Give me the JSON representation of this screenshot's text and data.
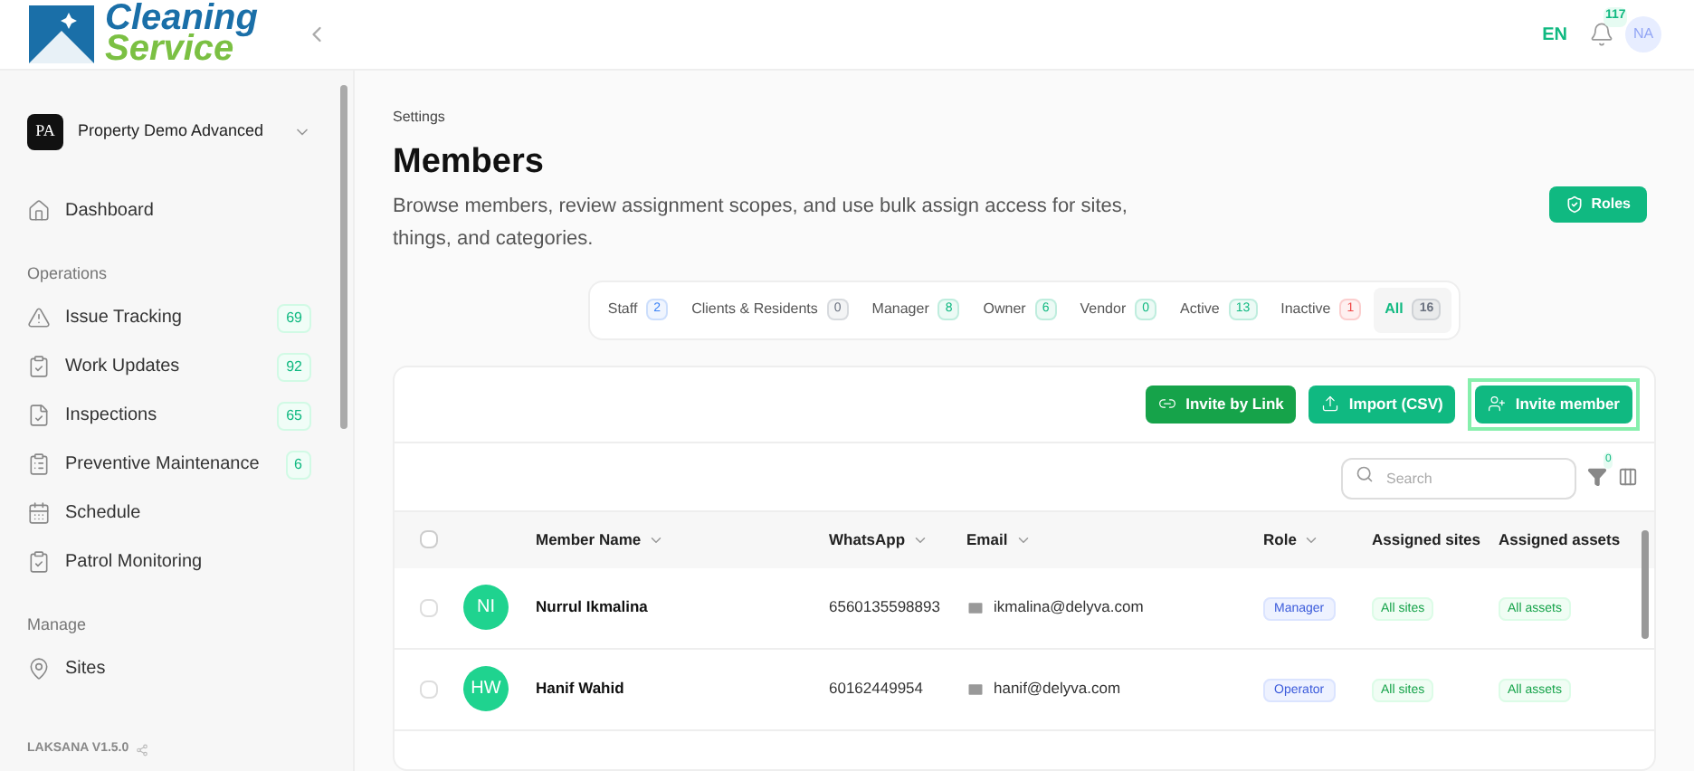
{
  "header": {
    "logo": [
      "Cleaning",
      "Service"
    ],
    "language": {
      "label": "EN",
      "selected": true
    },
    "notifications": "117",
    "avatar": "NA"
  },
  "sidebar": {
    "workspace": {
      "initials": "PA",
      "name": "Property Demo Advanced"
    },
    "items": [
      {
        "label": "Dashboard"
      }
    ],
    "sections": [
      {
        "title": "Operations",
        "items": [
          {
            "label": "Issue Tracking",
            "count": "69"
          },
          {
            "label": "Work Updates",
            "count": "92"
          },
          {
            "label": "Inspections",
            "count": "65"
          },
          {
            "label": "Preventive Maintenance",
            "count": "6"
          },
          {
            "label": "Schedule"
          },
          {
            "label": "Patrol Monitoring"
          }
        ]
      },
      {
        "title": "Manage",
        "items": [
          {
            "label": "Sites"
          }
        ]
      }
    ],
    "version": "LAKSANA V1.5.0"
  },
  "page": {
    "breadcrumb": "Settings",
    "title": "Members",
    "description": "Browse members, review assignment scopes, and use bulk assign access for sites, things, and categories.",
    "roles_button": "Roles"
  },
  "tabs": [
    {
      "label": "Staff",
      "count": "2",
      "color": "#3b82f6",
      "selected": false
    },
    {
      "label": "Clients & Residents",
      "count": "0",
      "color": "#6b7280",
      "selected": false
    },
    {
      "label": "Manager",
      "count": "8",
      "color": "#10b981",
      "selected": false
    },
    {
      "label": "Owner",
      "count": "6",
      "color": "#10b981",
      "selected": false
    },
    {
      "label": "Vendor",
      "count": "0",
      "color": "#10b981",
      "selected": false
    },
    {
      "label": "Active",
      "count": "13",
      "color": "#10b981",
      "selected": false
    },
    {
      "label": "Inactive",
      "count": "1",
      "color": "#ef4444",
      "selected": false
    },
    {
      "label": "All",
      "count": "16",
      "color": "#6b7280",
      "selected": true
    }
  ],
  "actions": [
    {
      "label": "Invite by Link",
      "focused": false
    },
    {
      "label": "Import (CSV)",
      "focused": false
    },
    {
      "label": "Invite member",
      "focused": true
    }
  ],
  "search": {
    "placeholder": "Search"
  },
  "filter_count": "0",
  "table": {
    "all_checked": false,
    "columns": [
      {
        "label": "Member Name",
        "sortable": true
      },
      {
        "label": "WhatsApp",
        "sortable": true
      },
      {
        "label": "Email",
        "sortable": true
      },
      {
        "label": "Role",
        "sortable": true
      },
      {
        "label": "Assigned sites",
        "sortable": false
      },
      {
        "label": "Assigned assets",
        "sortable": false
      }
    ],
    "rows": [
      {
        "initials": "NI",
        "name": "Nurrul Ikmalina",
        "whatsapp": "6560135598893",
        "email": "ikmalina@delyva.com",
        "role": "Manager",
        "sites": "All sites",
        "assets": "All assets",
        "checked": false
      },
      {
        "initials": "HW",
        "name": "Hanif Wahid",
        "whatsapp": "60162449954",
        "email": "hanif@delyva.com",
        "role": "Operator",
        "sites": "All sites",
        "assets": "All assets",
        "checked": false
      }
    ]
  }
}
